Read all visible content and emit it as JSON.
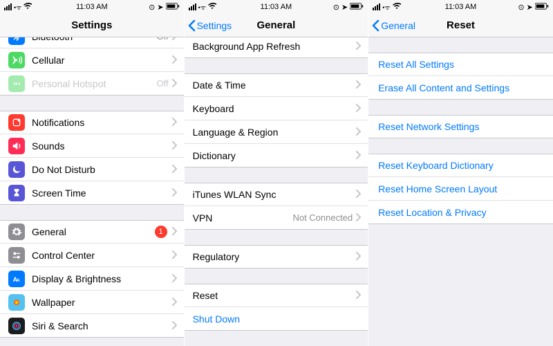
{
  "status": {
    "time": "11:03 AM"
  },
  "screen1": {
    "title": "Settings",
    "offset": -52,
    "rows": [
      {
        "kind": "cell",
        "name": "wifi-cell",
        "icon": "wifi",
        "icon_bg": "#007aff",
        "label": "",
        "value": "",
        "disclose": true
      },
      {
        "kind": "cell",
        "name": "bluetooth-cell",
        "icon": "bluetooth",
        "icon_bg": "#007aff",
        "label": "Bluetooth",
        "value": "Off",
        "disclose": true
      },
      {
        "kind": "cell",
        "name": "cellular-cell",
        "icon": "cellular",
        "icon_bg": "#4cd964",
        "label": "Cellular",
        "value": "",
        "disclose": true
      },
      {
        "kind": "cell",
        "name": "hotspot-cell",
        "icon": "hotspot",
        "icon_bg": "#4cd964",
        "label": "Personal Hotspot",
        "value": "Off",
        "disclose": true,
        "disabled": true
      },
      {
        "kind": "gap"
      },
      {
        "kind": "cell",
        "name": "notifications-cell",
        "icon": "notifications",
        "icon_bg": "#ff3b30",
        "label": "Notifications",
        "value": "",
        "disclose": true
      },
      {
        "kind": "cell",
        "name": "sounds-cell",
        "icon": "sounds",
        "icon_bg": "#ff2d55",
        "label": "Sounds",
        "value": "",
        "disclose": true
      },
      {
        "kind": "cell",
        "name": "dnd-cell",
        "icon": "moon",
        "icon_bg": "#5856d6",
        "label": "Do Not Disturb",
        "value": "",
        "disclose": true
      },
      {
        "kind": "cell",
        "name": "screentime-cell",
        "icon": "hourglass",
        "icon_bg": "#5856d6",
        "label": "Screen Time",
        "value": "",
        "disclose": true
      },
      {
        "kind": "gap"
      },
      {
        "kind": "cell",
        "name": "general-cell",
        "icon": "gear",
        "icon_bg": "#8e8e93",
        "label": "General",
        "value": "",
        "badge": "1",
        "disclose": true
      },
      {
        "kind": "cell",
        "name": "control-center-cell",
        "icon": "switches",
        "icon_bg": "#8e8e93",
        "label": "Control Center",
        "value": "",
        "disclose": true
      },
      {
        "kind": "cell",
        "name": "display-cell",
        "icon": "display",
        "icon_bg": "#007aff",
        "label": "Display & Brightness",
        "value": "",
        "disclose": true
      },
      {
        "kind": "cell",
        "name": "wallpaper-cell",
        "icon": "wallpaper",
        "icon_bg": "#55c1ef",
        "label": "Wallpaper",
        "value": "",
        "disclose": true
      },
      {
        "kind": "cell",
        "name": "siri-cell",
        "icon": "siri",
        "icon_bg": "#1c1c1e",
        "label": "Siri & Search",
        "value": "",
        "disclose": true
      }
    ]
  },
  "screen2": {
    "title": "General",
    "back": "Settings",
    "offset": -4,
    "rows": [
      {
        "kind": "cell",
        "name": "bg-app-refresh-cell",
        "label": "Background App Refresh",
        "disclose": true
      },
      {
        "kind": "gap"
      },
      {
        "kind": "cell",
        "name": "date-time-cell",
        "label": "Date & Time",
        "disclose": true
      },
      {
        "kind": "cell",
        "name": "keyboard-cell",
        "label": "Keyboard",
        "disclose": true
      },
      {
        "kind": "cell",
        "name": "language-region-cell",
        "label": "Language & Region",
        "disclose": true
      },
      {
        "kind": "cell",
        "name": "dictionary-cell",
        "label": "Dictionary",
        "disclose": true
      },
      {
        "kind": "gap"
      },
      {
        "kind": "cell",
        "name": "itunes-wlan-sync-cell",
        "label": "iTunes WLAN Sync",
        "disclose": true
      },
      {
        "kind": "cell",
        "name": "vpn-cell",
        "label": "VPN",
        "value": "Not Connected",
        "disclose": true
      },
      {
        "kind": "gap"
      },
      {
        "kind": "cell",
        "name": "regulatory-cell",
        "label": "Regulatory",
        "disclose": true
      },
      {
        "kind": "gap"
      },
      {
        "kind": "cell",
        "name": "reset-cell",
        "label": "Reset",
        "disclose": true
      },
      {
        "kind": "cell",
        "name": "shut-down-cell",
        "label": "Shut Down",
        "link": true
      },
      {
        "kind": "gap"
      }
    ]
  },
  "screen3": {
    "title": "Reset",
    "back": "General",
    "offset": 0,
    "rows": [
      {
        "kind": "gap"
      },
      {
        "kind": "cell",
        "name": "reset-all-settings-cell",
        "label": "Reset All Settings",
        "link": true
      },
      {
        "kind": "cell",
        "name": "erase-all-content-cell",
        "label": "Erase All Content and Settings",
        "link": true
      },
      {
        "kind": "gap"
      },
      {
        "kind": "cell",
        "name": "reset-network-cell",
        "label": "Reset Network Settings",
        "link": true
      },
      {
        "kind": "gap"
      },
      {
        "kind": "cell",
        "name": "reset-keyboard-dict-cell",
        "label": "Reset Keyboard Dictionary",
        "link": true
      },
      {
        "kind": "cell",
        "name": "reset-home-screen-cell",
        "label": "Reset Home Screen Layout",
        "link": true
      },
      {
        "kind": "cell",
        "name": "reset-location-privacy-cell",
        "label": "Reset Location & Privacy",
        "link": true
      }
    ]
  },
  "icons": {
    "wifi": "<svg viewBox='0 0 24 24' fill='white'><path d='M12 20l-2-2c1-1 3-1 4 0l-2 2zm-5-5l-2-2c4-4 10-4 14 0l-2 2c-3-3-7-3-10 0zm-3-4l-2-2c6-6 16-6 22 0l-2 2c-5-5-13-5-18 0z'/></svg>",
    "bluetooth": "<svg viewBox='0 0 24 24' fill='white'><path d='M12 2v8L7 5 5.5 6.5 11 12l-5.5 5.5L7 19l5-5v8l6-6-4-4 4-4-6-6zm2 4l2 2-2 2V6zm0 8l2 2-2 2v-4z'/></svg>",
    "cellular": "<svg viewBox='0 0 24 24' fill='white'><circle cx='12' cy='12' r='2'/><path d='M7 7a7 7 0 010 10M17 7a7 7 0 010 10M4 4a11 11 0 010 16M20 4a11 11 0 010 16' stroke='white' stroke-width='2' fill='none'/></svg>",
    "hotspot": "<svg viewBox='0 0 24 24' fill='white'><circle cx='12' cy='12' r='2'/><path d='M7 9a6 6 0 010 6M17 9a6 6 0 010 6' stroke='white' stroke-width='2' fill='none'/></svg>",
    "notifications": "<svg viewBox='0 0 24 24' fill='white'><rect x='5' y='5' width='14' height='14' rx='3' stroke='white' stroke-width='2' fill='none'/><circle cx='17' cy='7' r='3' fill='white'/></svg>",
    "sounds": "<svg viewBox='0 0 24 24' fill='white'><path d='M4 9v6h4l6 5V4l-6 5H4z'/><path d='M17 8a5 5 0 010 8' stroke='white' stroke-width='2' fill='none'/></svg>",
    "moon": "<svg viewBox='0 0 24 24' fill='white'><path d='M20 14A8 8 0 1110 4a6 6 0 0010 10z'/></svg>",
    "hourglass": "<svg viewBox='0 0 24 24' fill='white'><path d='M7 3h10v4l-4 4 4 4v4H7v-4l4-4-4-4V3z'/></svg>",
    "gear": "<svg viewBox='0 0 24 24' fill='white'><path d='M12 8a4 4 0 100 8 4 4 0 000-8zm9 4l2 1-1 3-2-.5a8 8 0 01-1.5 1.5l.5 2-3 1-1-2h-2l-1 2-3-1 .5-2A8 8 0 016 16.5L4 17l-1-3 2-1v-2L3 10l1-3 2 .5A8 8 0 017.5 6L7 4l3-1 1 2h2l1-2 3 1-.5 2A8 8 0 0118 7.5l2-.5 1 3-2 1v2z'/></svg>",
    "switches": "<svg viewBox='0 0 24 24' fill='white'><circle cx='8' cy='8' r='3'/><rect x='11' y='7' width='9' height='2'/><circle cx='16' cy='16' r='3'/><rect x='4' y='15' width='9' height='2'/></svg>",
    "display": "<svg viewBox='0 0 24 24' fill='white'><text x='4' y='18' font-size='14' font-weight='bold' fill='white'>A</text><text x='12' y='18' font-size='10' font-weight='bold' fill='white'>A</text></svg>",
    "wallpaper": "<svg viewBox='0 0 24 24' fill='white'><circle cx='12' cy='12' r='6' fill='#ff6a00'/><circle cx='12' cy='12' r='3' fill='#ffd400'/></svg>",
    "siri": "<svg viewBox='0 0 24 24' fill='none'><circle cx='12' cy='12' r='8' stroke='#19c3ff' stroke-width='2'/><circle cx='12' cy='12' r='5' stroke='#ff2d55' stroke-width='2'/><circle cx='12' cy='12' r='2' fill='#9b59ff'/></svg>"
  }
}
